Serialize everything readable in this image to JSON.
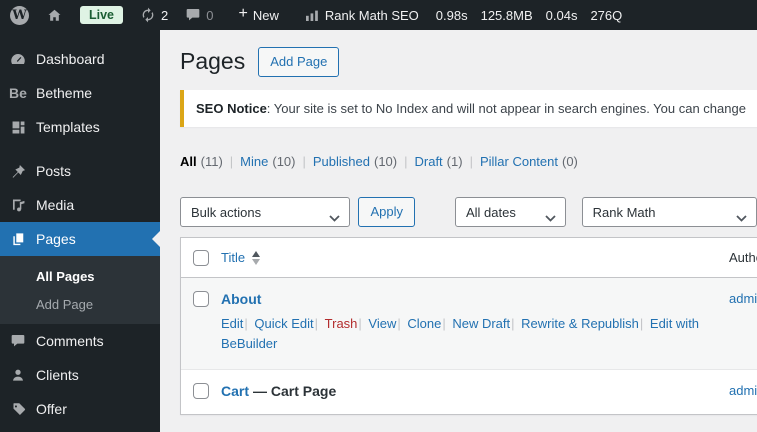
{
  "admin_bar": {
    "logo": "W",
    "live_badge": "Live",
    "updates_count": "2",
    "comments_count": "0",
    "new_label": "New",
    "seo_label": "Rank Math SEO",
    "stat_time": "0.98s",
    "stat_memory": "125.8MB",
    "stat_query_time": "0.04s",
    "stat_queries": "276Q"
  },
  "sidebar": {
    "betheme_icon_text": "Be",
    "items": [
      {
        "label": "Dashboard"
      },
      {
        "label": "Betheme"
      },
      {
        "label": "Templates"
      },
      {
        "label": "Posts"
      },
      {
        "label": "Media"
      },
      {
        "label": "Pages"
      },
      {
        "label": "Comments"
      },
      {
        "label": "Clients"
      },
      {
        "label": "Offer"
      }
    ],
    "submenu": [
      {
        "label": "All Pages"
      },
      {
        "label": "Add Page"
      }
    ]
  },
  "page": {
    "title": "Pages",
    "add_page_button": "Add Page"
  },
  "notice": {
    "title": "SEO Notice",
    "message": ": Your site is set to No Index and will not appear in search engines. You can change"
  },
  "views": [
    {
      "label": "All",
      "count": "(11)"
    },
    {
      "label": "Mine",
      "count": "(10)"
    },
    {
      "label": "Published",
      "count": "(10)"
    },
    {
      "label": "Draft",
      "count": "(1)"
    },
    {
      "label": "Pillar Content",
      "count": "(0)"
    }
  ],
  "toolbar": {
    "bulk_actions": "Bulk actions",
    "apply_button": "Apply",
    "date_filter": "All dates",
    "seo_filter": "Rank Math"
  },
  "table": {
    "title_column": "Title",
    "author_column": "Author",
    "rows": [
      {
        "title": "About",
        "author": "admin",
        "actions": {
          "edit": "Edit",
          "quick_edit": "Quick Edit",
          "trash": "Trash",
          "view": "View",
          "clone": "Clone",
          "new_draft": "New Draft",
          "rewrite": "Rewrite & Republish",
          "bebuilder": "Edit with BeBuilder"
        }
      },
      {
        "title": "Cart",
        "state": "— Cart Page",
        "author": "admin"
      }
    ]
  },
  "colors": {
    "accent": "#2271b1",
    "warning_border": "#dba617",
    "danger": "#b32d2e",
    "admin_bar_bg": "#1d2327",
    "submenu_bg": "#2c3338",
    "content_bg": "#f0f0f1",
    "stripe_row_bg": "#f6f7f7",
    "live_badge_bg": "#dff3e4",
    "live_badge_text": "#1b5e33"
  }
}
